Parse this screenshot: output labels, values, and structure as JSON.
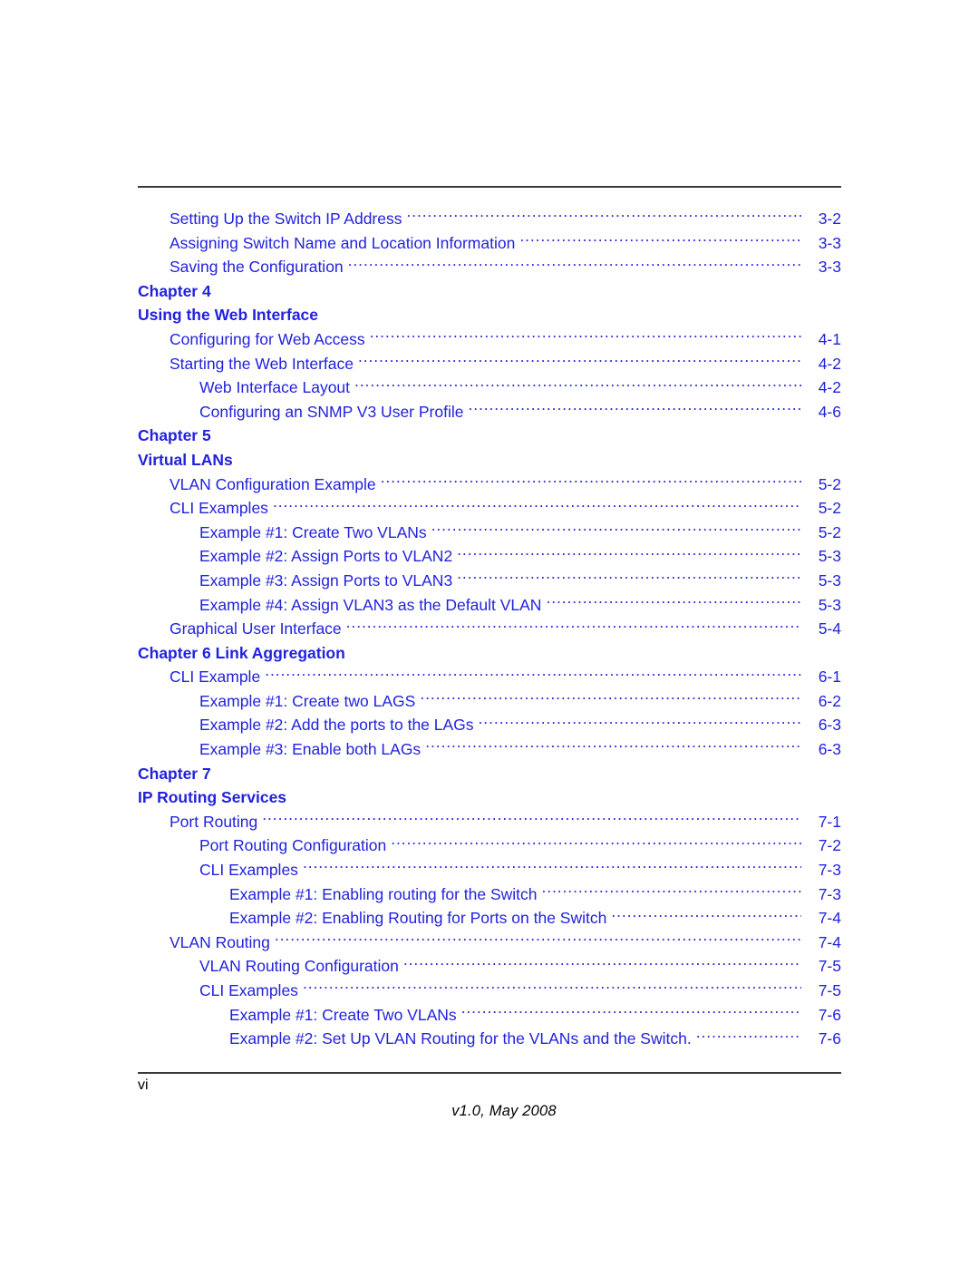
{
  "document": {
    "kind": "table-of-contents",
    "folio": "vi",
    "version_line": "v1.0, May 2008",
    "text_color": "#2222dd",
    "rule_color": "#3a3a3a"
  },
  "toc": {
    "rows": [
      {
        "type": "entry",
        "level": 1,
        "label": "Setting Up the Switch IP Address",
        "page": "3-2"
      },
      {
        "type": "entry",
        "level": 1,
        "label": "Assigning Switch Name and Location Information",
        "page": "3-3"
      },
      {
        "type": "entry",
        "level": 1,
        "label": "Saving the Configuration",
        "page": "3-3"
      },
      {
        "type": "chapter",
        "line1": "Chapter 4",
        "line2": "Using the Web Interface"
      },
      {
        "type": "entry",
        "level": 1,
        "label": "Configuring for Web Access",
        "page": "4-1"
      },
      {
        "type": "entry",
        "level": 1,
        "label": "Starting the Web Interface",
        "page": "4-2"
      },
      {
        "type": "entry",
        "level": 2,
        "label": "Web Interface Layout",
        "page": "4-2"
      },
      {
        "type": "entry",
        "level": 2,
        "label": "Configuring an SNMP V3 User Profile",
        "page": "4-6"
      },
      {
        "type": "chapter",
        "line1": "Chapter 5",
        "line2": "Virtual LANs"
      },
      {
        "type": "entry",
        "level": 1,
        "label": "VLAN Configuration Example",
        "page": "5-2"
      },
      {
        "type": "entry",
        "level": 1,
        "label": "CLI Examples",
        "page": "5-2"
      },
      {
        "type": "entry",
        "level": 2,
        "label": "Example #1: Create Two VLANs",
        "page": "5-2"
      },
      {
        "type": "entry",
        "level": 2,
        "label": "Example #2: Assign Ports to VLAN2",
        "page": "5-3"
      },
      {
        "type": "entry",
        "level": 2,
        "label": "Example #3: Assign Ports to VLAN3",
        "page": "5-3"
      },
      {
        "type": "entry",
        "level": 2,
        "label": "Example #4: Assign VLAN3 as the Default VLAN",
        "page": "5-3"
      },
      {
        "type": "entry",
        "level": 1,
        "label": "Graphical User Interface",
        "page": "5-4"
      },
      {
        "type": "chapter",
        "line1": "Chapter 6 Link Aggregation",
        "line2": ""
      },
      {
        "type": "entry",
        "level": 1,
        "label": "CLI Example",
        "page": "6-1"
      },
      {
        "type": "entry",
        "level": 2,
        "label": "Example #1: Create two LAGS",
        "page": "6-2"
      },
      {
        "type": "entry",
        "level": 2,
        "label": "Example #2: Add the ports to the LAGs",
        "page": "6-3"
      },
      {
        "type": "entry",
        "level": 2,
        "label": "Example #3: Enable both LAGs",
        "page": "6-3"
      },
      {
        "type": "chapter",
        "line1": "Chapter 7",
        "line2": "IP Routing Services"
      },
      {
        "type": "entry",
        "level": 1,
        "label": "Port Routing",
        "page": "7-1"
      },
      {
        "type": "entry",
        "level": 2,
        "label": "Port Routing Configuration",
        "page": "7-2"
      },
      {
        "type": "entry",
        "level": 2,
        "label": "CLI Examples",
        "page": "7-3"
      },
      {
        "type": "entry",
        "level": 3,
        "label": "Example #1: Enabling routing for the Switch",
        "page": "7-3"
      },
      {
        "type": "entry",
        "level": 3,
        "label": "Example #2: Enabling Routing for Ports on the Switch",
        "page": "7-4"
      },
      {
        "type": "entry",
        "level": 1,
        "label": "VLAN Routing",
        "page": "7-4"
      },
      {
        "type": "entry",
        "level": 2,
        "label": "VLAN Routing Configuration",
        "page": "7-5"
      },
      {
        "type": "entry",
        "level": 2,
        "label": "CLI Examples",
        "page": "7-5"
      },
      {
        "type": "entry",
        "level": 3,
        "label": "Example #1: Create Two VLANs",
        "page": "7-6"
      },
      {
        "type": "entry",
        "level": 3,
        "label": "Example #2: Set Up VLAN Routing for the VLANs and the Switch.",
        "page": "7-6"
      }
    ]
  }
}
